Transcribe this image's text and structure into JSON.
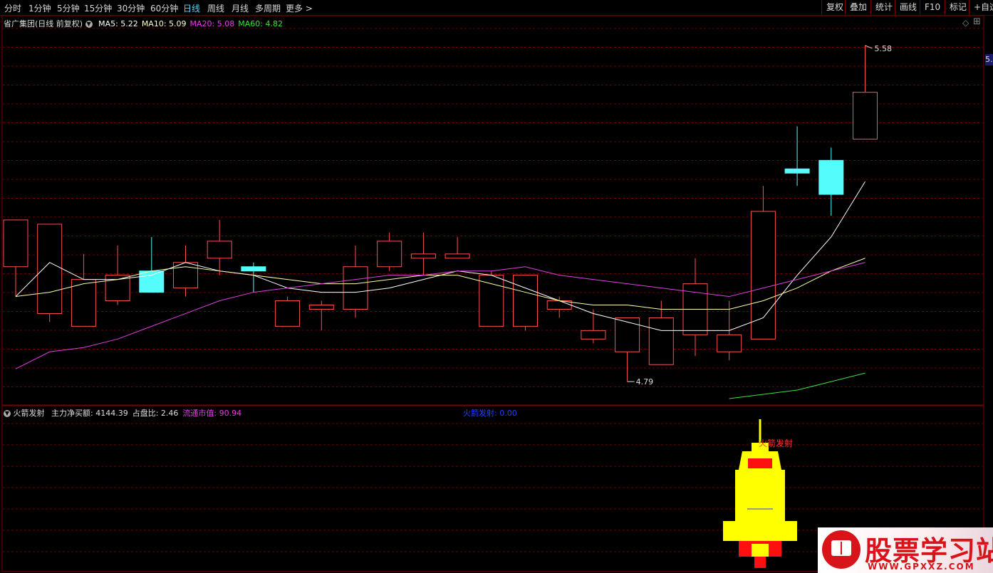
{
  "toolbar": {
    "periods": [
      "分时",
      "1分钟",
      "5分钟",
      "15分钟",
      "30分钟",
      "60分钟",
      "日线",
      "周线",
      "月线",
      "多周期",
      "更多 >"
    ],
    "active_period": "日线",
    "right_buttons": [
      "复权",
      "叠加",
      "统计",
      "画线",
      "F10",
      "标记",
      "+自选"
    ]
  },
  "main_panel": {
    "title": "省广集团(日线 前复权)",
    "ma_labels": [
      {
        "text": "MA5: 5.22",
        "color": "#ffffff"
      },
      {
        "text": "MA10: 5.09",
        "color": "#ffffcc"
      },
      {
        "text": "MA20: 5.08",
        "color": "#e040e0"
      },
      {
        "text": "MA60: 4.82",
        "color": "#40e040"
      }
    ],
    "high_label": "5.58",
    "low_label": "4.79",
    "right_edge_price": "5."
  },
  "sub_panel": {
    "indicator_name": "火箭发射",
    "fields": [
      {
        "text": "主力净买额: 4144.39",
        "color": "#dddddd"
      },
      {
        "text": "占盘比: 2.46",
        "color": "#dddddd"
      },
      {
        "text": "流通市值: 90.94",
        "color": "#e040e0"
      }
    ],
    "center_label": "火箭发射: 0.00",
    "rocket_label": "火箭发射"
  },
  "watermark": {
    "title": "股票学习站",
    "url": "WWW.GPXXZ.COM"
  },
  "chart_data": {
    "type": "candlestick",
    "candles": [
      {
        "o": 5.06,
        "h": 5.11,
        "l": 4.99,
        "c": 5.17
      },
      {
        "o": 4.95,
        "h": 5.12,
        "l": 4.93,
        "c": 5.16
      },
      {
        "o": 4.92,
        "h": 5.09,
        "l": 4.92,
        "c": 5.03
      },
      {
        "o": 4.98,
        "h": 5.11,
        "l": 4.97,
        "c": 5.04
      },
      {
        "o": 5.05,
        "h": 5.13,
        "l": 5.01,
        "c": 5.0
      },
      {
        "o": 5.01,
        "h": 5.11,
        "l": 4.99,
        "c": 5.07
      },
      {
        "o": 5.08,
        "h": 5.17,
        "l": 5.04,
        "c": 5.12
      },
      {
        "o": 5.06,
        "h": 5.07,
        "l": 5.0,
        "c": 5.05
      },
      {
        "o": 4.92,
        "h": 4.99,
        "l": 4.94,
        "c": 4.98
      },
      {
        "o": 4.96,
        "h": 4.98,
        "l": 4.91,
        "c": 4.97
      },
      {
        "o": 4.96,
        "h": 5.11,
        "l": 4.94,
        "c": 5.06
      },
      {
        "o": 5.06,
        "h": 5.14,
        "l": 5.05,
        "c": 5.12
      },
      {
        "o": 5.08,
        "h": 5.14,
        "l": 5.04,
        "c": 5.09
      },
      {
        "o": 5.08,
        "h": 5.13,
        "l": 5.09,
        "c": 5.09
      },
      {
        "o": 4.92,
        "h": 5.05,
        "l": 4.93,
        "c": 5.04
      },
      {
        "o": 4.92,
        "h": 5.04,
        "l": 4.91,
        "c": 5.04
      },
      {
        "o": 4.96,
        "h": 4.99,
        "l": 4.94,
        "c": 4.98
      },
      {
        "o": 4.89,
        "h": 4.96,
        "l": 4.88,
        "c": 4.91
      },
      {
        "o": 4.86,
        "h": 4.93,
        "l": 4.79,
        "c": 4.94
      },
      {
        "o": 4.83,
        "h": 4.98,
        "l": 4.84,
        "c": 4.94
      },
      {
        "o": 4.9,
        "h": 5.08,
        "l": 4.85,
        "c": 5.02
      },
      {
        "o": 4.86,
        "h": 4.98,
        "l": 4.84,
        "c": 4.9
      },
      {
        "o": 4.89,
        "h": 5.25,
        "l": 4.9,
        "c": 5.19
      },
      {
        "o": 5.29,
        "h": 5.39,
        "l": 5.25,
        "c": 5.28
      },
      {
        "o": 5.31,
        "h": 5.34,
        "l": 5.18,
        "c": 5.23
      },
      {
        "o": 5.36,
        "h": 5.58,
        "l": 5.39,
        "c": 5.47
      }
    ],
    "ma5": [
      4.99,
      5.07,
      5.03,
      5.03,
      5.04,
      5.07,
      5.05,
      5.04,
      5.01,
      5.0,
      5.0,
      5.01,
      5.03,
      5.05,
      5.04,
      5.01,
      4.98,
      4.95,
      4.93,
      4.91,
      4.91,
      4.91,
      4.94,
      5.04,
      5.13,
      5.26
    ],
    "ma10": [
      4.99,
      5.0,
      5.02,
      5.03,
      5.05,
      5.06,
      5.05,
      5.04,
      5.03,
      5.02,
      5.02,
      5.03,
      5.04,
      5.04,
      5.02,
      5.0,
      4.98,
      4.97,
      4.97,
      4.96,
      4.96,
      4.96,
      4.98,
      5.01,
      5.05,
      5.08
    ],
    "ma20": [
      4.82,
      4.86,
      4.87,
      4.89,
      4.92,
      4.95,
      4.98,
      5.0,
      5.01,
      5.02,
      5.03,
      5.04,
      5.04,
      5.05,
      5.05,
      5.06,
      5.04,
      5.03,
      5.02,
      5.01,
      5.0,
      4.99,
      5.01,
      5.03,
      5.05,
      5.07
    ],
    "ma60": [
      4.75,
      4.76,
      4.77,
      4.79,
      4.81
    ],
    "ylim": [
      4.75,
      5.62
    ]
  }
}
